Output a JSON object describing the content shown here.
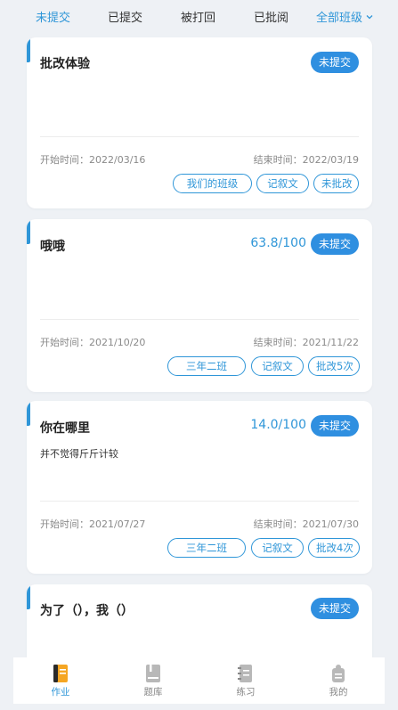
{
  "tabs": [
    {
      "label": "未提交"
    },
    {
      "label": "已提交"
    },
    {
      "label": "被打回"
    },
    {
      "label": "已批阅"
    }
  ],
  "class_filter": {
    "label": "全部班级"
  },
  "colors": {
    "accent": "#2f96d8",
    "badge": "#2f8fe0",
    "background": "#eef1f5"
  },
  "cards": [
    {
      "title": "批改体验",
      "description": "",
      "score": "",
      "status": "未提交",
      "start_label": "开始时间：",
      "start_date": "2022/03/16",
      "end_label": "结束时间：",
      "end_date": "2022/03/19",
      "tags": [
        "我们的班级",
        "记叙文",
        "未批改"
      ]
    },
    {
      "title": "哦哦",
      "description": "",
      "score": "63.8/100",
      "status": "未提交",
      "start_label": "开始时间：",
      "start_date": "2021/10/20",
      "end_label": "结束时间：",
      "end_date": "2021/11/22",
      "tags": [
        "三年二班",
        "记叙文",
        "批改5次"
      ]
    },
    {
      "title": "你在哪里",
      "description": "并不觉得斤斤计较",
      "score": "14.0/100",
      "status": "未提交",
      "start_label": "开始时间：",
      "start_date": "2021/07/27",
      "end_label": "结束时间：",
      "end_date": "2021/07/30",
      "tags": [
        "三年二班",
        "记叙文",
        "批改4次"
      ]
    },
    {
      "title": "为了（），我（）",
      "status": "未提交"
    }
  ],
  "bottom_nav": [
    {
      "label": "作业",
      "icon": "homework-icon"
    },
    {
      "label": "题库",
      "icon": "question-bank-icon"
    },
    {
      "label": "练习",
      "icon": "practice-icon"
    },
    {
      "label": "我的",
      "icon": "profile-icon"
    }
  ]
}
